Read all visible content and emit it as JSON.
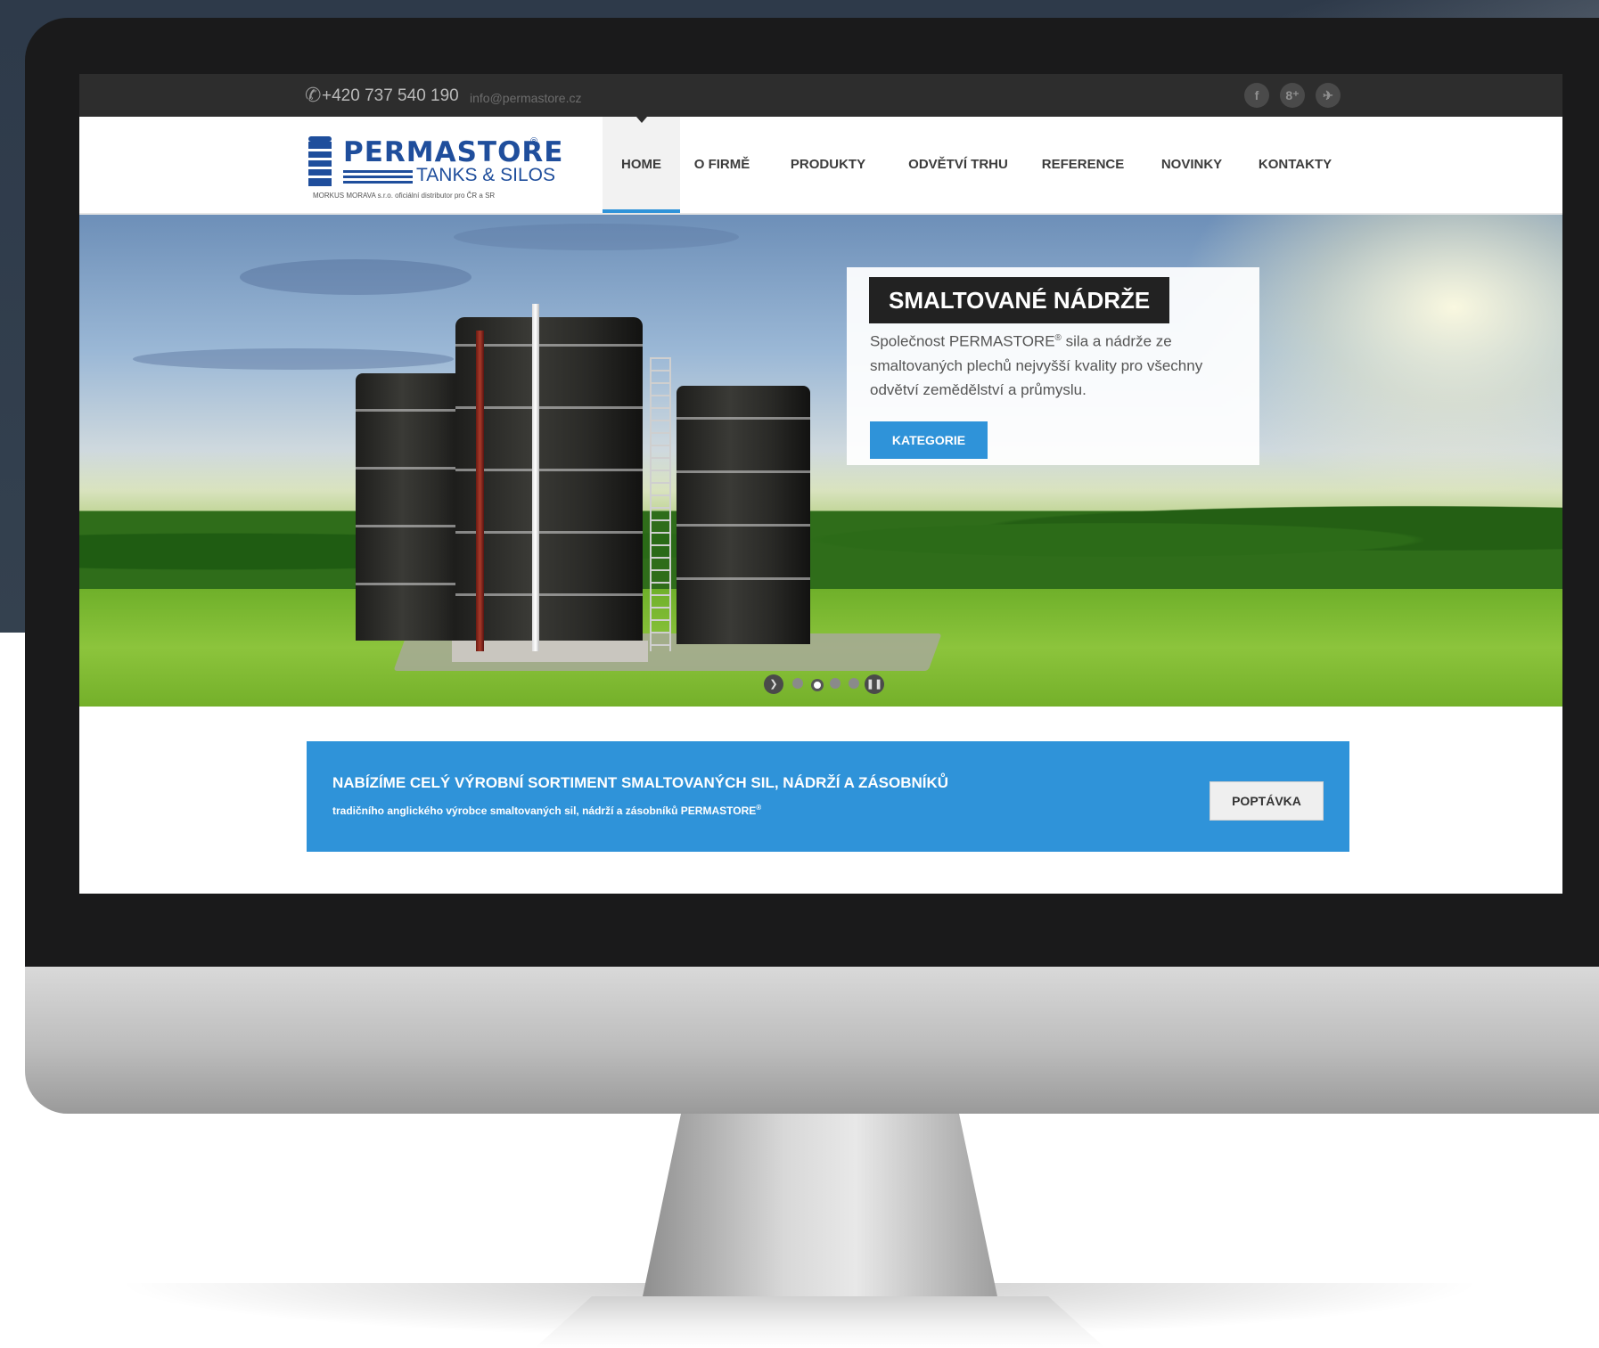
{
  "topbar": {
    "phone": "+420 737 540 190",
    "email": "info@permastore.cz",
    "social": [
      "facebook-icon",
      "google-plus-icon",
      "twitter-icon"
    ]
  },
  "logo": {
    "name": "PERMASTORE",
    "registered": "®",
    "sub": "TANKS & SILOS",
    "tagline": "MORKUS MORAVA s.r.o. oficiální distributor pro ČR a SR"
  },
  "nav": {
    "items": [
      {
        "label": "HOME",
        "active": true
      },
      {
        "label": "O FIRMĚ"
      },
      {
        "label": "PRODUKTY"
      },
      {
        "label": "ODVĚTVÍ TRHU"
      },
      {
        "label": "REFERENCE"
      },
      {
        "label": "NOVINKY"
      },
      {
        "label": "KONTAKTY"
      }
    ]
  },
  "hero": {
    "title": "SMALTOVANÉ NÁDRŽE",
    "text_before": "Společnost PERMASTORE",
    "text_reg": "®",
    "text_after": " sila a nádrže ze smaltovaných plechů nejvyšší kvality pro všechny odvětví zemědělství a průmyslu.",
    "button": "KATEGORIE",
    "slides": 4,
    "active_slide": 2
  },
  "promo": {
    "heading": "NABÍZÍME CELÝ VÝROBNÍ SORTIMENT SMALTOVANÝCH SIL, NÁDRŽÍ A ZÁSOBNÍKŮ",
    "sub": "tradičního anglického výrobce smaltovaných sil, nádrží a zásobníků PERMASTORE",
    "sub_reg": "®",
    "button": "POPTÁVKA"
  },
  "colors": {
    "accent": "#2f93d9",
    "topbar": "#2d2d2d",
    "brand": "#1f4e9c"
  }
}
